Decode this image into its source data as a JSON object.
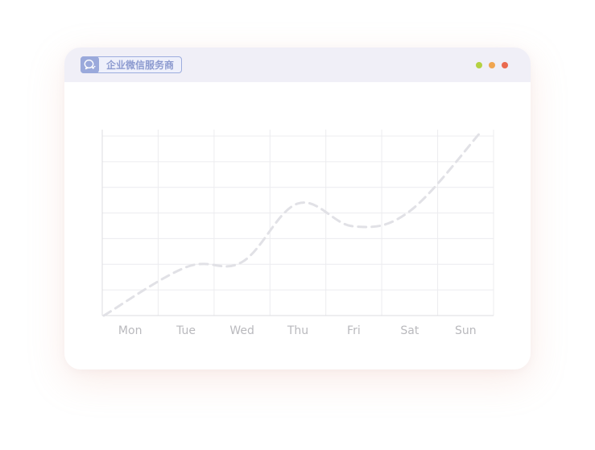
{
  "app": {
    "brand_label": "企业微信服务商"
  },
  "window_controls": {
    "colors": [
      "#b4d142",
      "#f0a550",
      "#ea6a4f"
    ]
  },
  "icons": {
    "brand": "chat-bubble-icon"
  },
  "colors": {
    "titlebar": "#f0eff7",
    "brand_accent": "#9aa9db",
    "grid": "#ececef",
    "line": "#e1e1e6",
    "axis_text": "#b9b9bd"
  },
  "chart_data": {
    "type": "line",
    "categories": [
      "Mon",
      "Tue",
      "Wed",
      "Thu",
      "Fri",
      "Sat",
      "Sun"
    ],
    "series": [
      {
        "values": [
          0.0,
          1.9,
          2.1,
          4.4,
          3.5,
          4.1,
          7.2
        ],
        "style": "dashed",
        "smooth": true
      }
    ],
    "ylim": [
      0,
      7.3
    ],
    "grid": true,
    "y_tick_labels_shown": false
  }
}
